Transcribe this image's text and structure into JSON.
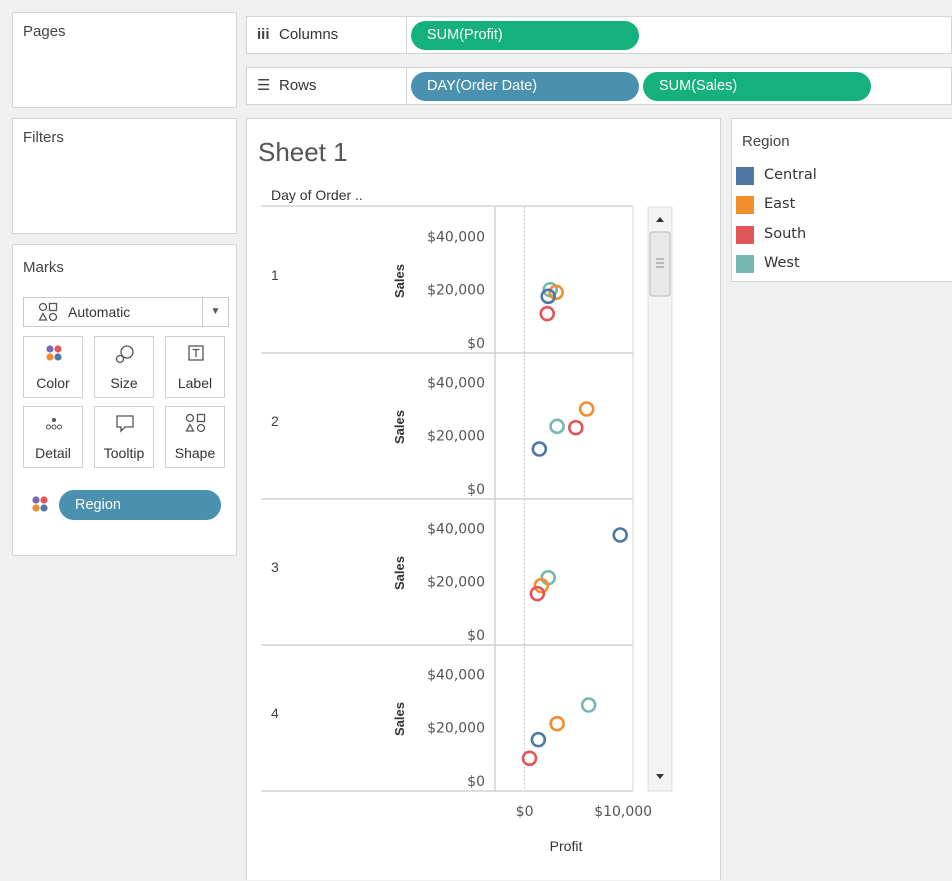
{
  "shelves": {
    "pages_title": "Pages",
    "filters_title": "Filters",
    "columns": {
      "label": "Columns",
      "icon": "columns-icon",
      "pills": [
        "SUM(Profit)"
      ]
    },
    "rows": {
      "label": "Rows",
      "icon": "rows-icon",
      "pills": [
        "DAY(Order Date)",
        "SUM(Sales)"
      ]
    }
  },
  "marks": {
    "title": "Marks",
    "mark_type": "Automatic",
    "buttons": [
      {
        "label": "Color",
        "icon": "color-icon"
      },
      {
        "label": "Size",
        "icon": "size-icon"
      },
      {
        "label": "Label",
        "icon": "label-icon"
      },
      {
        "label": "Detail",
        "icon": "detail-icon"
      },
      {
        "label": "Tooltip",
        "icon": "tooltip-icon"
      },
      {
        "label": "Shape",
        "icon": "shape-icon"
      }
    ],
    "color_field": "Region"
  },
  "sheet": {
    "title": "Sheet 1",
    "row_header": "Day of Order .."
  },
  "legend": {
    "title": "Region",
    "items": [
      {
        "label": "Central",
        "color": "#4e79a7"
      },
      {
        "label": "East",
        "color": "#f28e2b"
      },
      {
        "label": "South",
        "color": "#e15759"
      },
      {
        "label": "West",
        "color": "#76b7b2"
      }
    ]
  },
  "chart_data": {
    "type": "scatter",
    "xlabel": "Profit",
    "ylabel": "Sales",
    "x_ticks": [
      "$0",
      "$10,000"
    ],
    "y_ticks": [
      "$0",
      "$20,000",
      "$40,000"
    ],
    "xlim": [
      -3000,
      11000
    ],
    "ylim": [
      0,
      48000
    ],
    "panes": [
      {
        "label": "1",
        "points": [
          {
            "region": "West",
            "x": 2600,
            "y": 20000
          },
          {
            "region": "East",
            "x": 3200,
            "y": 19000
          },
          {
            "region": "Central",
            "x": 2400,
            "y": 17500
          },
          {
            "region": "South",
            "x": 2300,
            "y": 11000
          }
        ]
      },
      {
        "label": "2",
        "points": [
          {
            "region": "East",
            "x": 6300,
            "y": 30000
          },
          {
            "region": "West",
            "x": 3300,
            "y": 23500
          },
          {
            "region": "South",
            "x": 5200,
            "y": 23000
          },
          {
            "region": "Central",
            "x": 1500,
            "y": 15000
          }
        ]
      },
      {
        "label": "3",
        "points": [
          {
            "region": "Central",
            "x": 9700,
            "y": 37500
          },
          {
            "region": "West",
            "x": 2400,
            "y": 21500
          },
          {
            "region": "East",
            "x": 1700,
            "y": 18500
          },
          {
            "region": "South",
            "x": 1300,
            "y": 15500
          }
        ]
      },
      {
        "label": "4",
        "points": [
          {
            "region": "West",
            "x": 6500,
            "y": 28500
          },
          {
            "region": "East",
            "x": 3300,
            "y": 21500
          },
          {
            "region": "Central",
            "x": 1400,
            "y": 15500
          },
          {
            "region": "South",
            "x": 500,
            "y": 8500
          }
        ]
      }
    ]
  }
}
